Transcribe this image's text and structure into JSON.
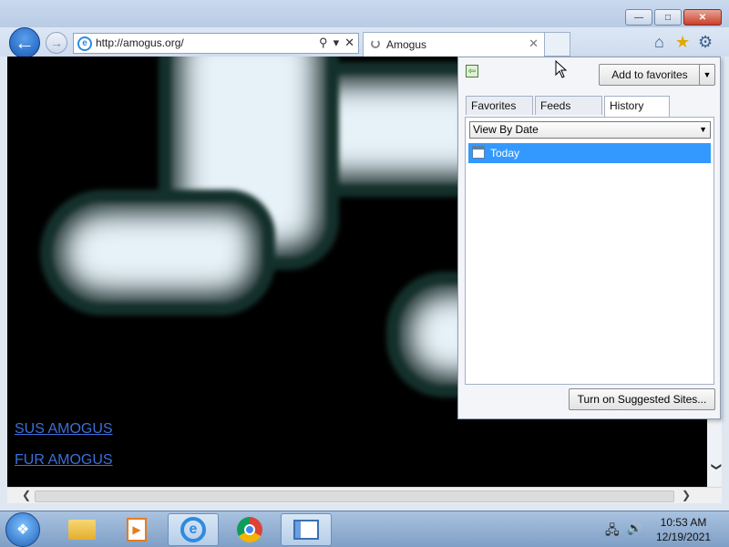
{
  "window": {
    "minimize_label": "—",
    "maximize_label": "□",
    "close_label": "✕"
  },
  "nav": {
    "back_icon": "back-arrow-icon",
    "forward_icon": "forward-arrow-icon",
    "url": "http://amogus.org/",
    "search_glyph": "⚲",
    "dropdown_glyph": "▾",
    "stop_glyph": "✕"
  },
  "tab": {
    "title": "Amogus",
    "close_glyph": "✕"
  },
  "commandbar": {
    "home_glyph": "⌂",
    "favorites_glyph": "★",
    "tools_glyph": "⚙"
  },
  "page": {
    "links": [
      {
        "label": "SUS AMOGUS"
      },
      {
        "label": "FUR AMOGUS"
      }
    ]
  },
  "favorites_panel": {
    "add_button": "Add to favorites",
    "add_dropdown": "▼",
    "tabs": [
      {
        "label": "Favorites",
        "active": false
      },
      {
        "label": "Feeds",
        "active": false
      },
      {
        "label": "History",
        "active": true
      }
    ],
    "view_select": "View By Date",
    "select_arrow": "▼",
    "history_items": [
      {
        "label": "Today",
        "selected": true
      }
    ],
    "suggest_button": "Turn on Suggested Sites..."
  },
  "taskbar": {
    "start_glyph": "❖",
    "apps": [
      {
        "name": "explorer"
      },
      {
        "name": "media-player",
        "glyph": "▶"
      },
      {
        "name": "internet-explorer",
        "glyph": "e",
        "active": true
      },
      {
        "name": "chrome"
      },
      {
        "name": "control-panel"
      }
    ],
    "tray_network": "🖧",
    "tray_volume": "🔊",
    "time": "10:53 AM",
    "date": "12/19/2021"
  },
  "colors": {
    "accent": "#3399ff",
    "link": "#3b6fd8",
    "close": "#c9402a"
  }
}
